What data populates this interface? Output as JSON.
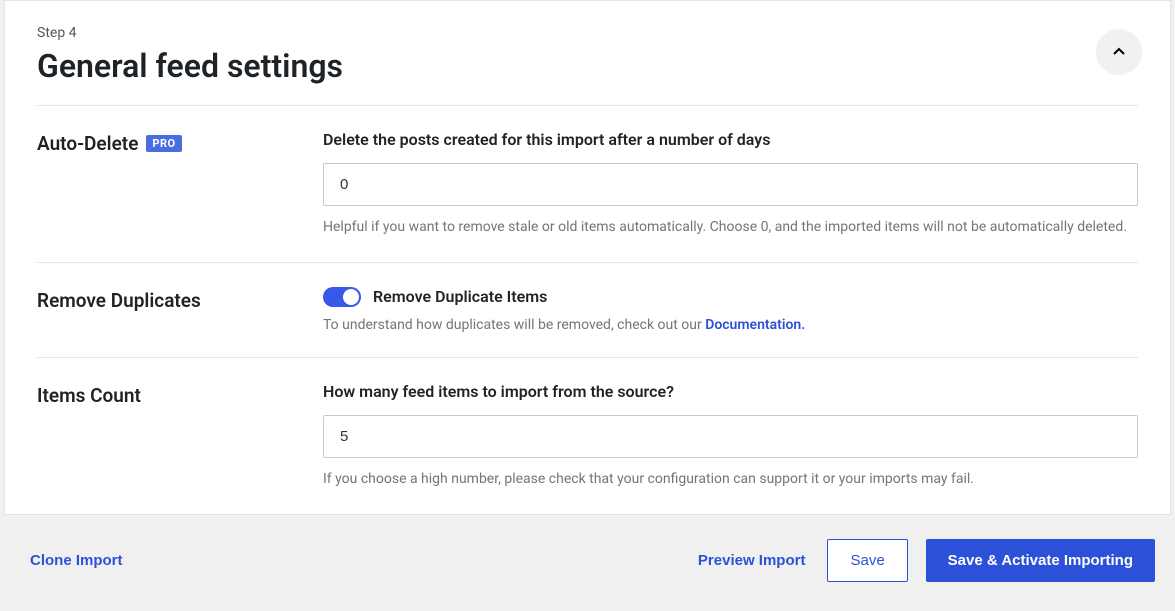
{
  "header": {
    "step": "Step 4",
    "title": "General feed settings"
  },
  "fields": {
    "autoDelete": {
      "label": "Auto-Delete",
      "badge": "PRO",
      "description": "Delete the posts created for this import after a number of days",
      "value": "0",
      "help": "Helpful if you want to remove stale or old items automatically. Choose 0, and the imported items will not be automatically deleted."
    },
    "removeDuplicates": {
      "label": "Remove Duplicates",
      "toggleLabel": "Remove Duplicate Items",
      "helpPrefix": "To understand how duplicates will be removed, check out our ",
      "docLink": "Documentation."
    },
    "itemsCount": {
      "label": "Items Count",
      "description": "How many feed items to import from the source?",
      "value": "5",
      "help": "If you choose a high number, please check that your configuration can support it or your imports may fail."
    }
  },
  "footer": {
    "clone": "Clone Import",
    "preview": "Preview Import",
    "save": "Save",
    "activate": "Save & Activate Importing"
  }
}
